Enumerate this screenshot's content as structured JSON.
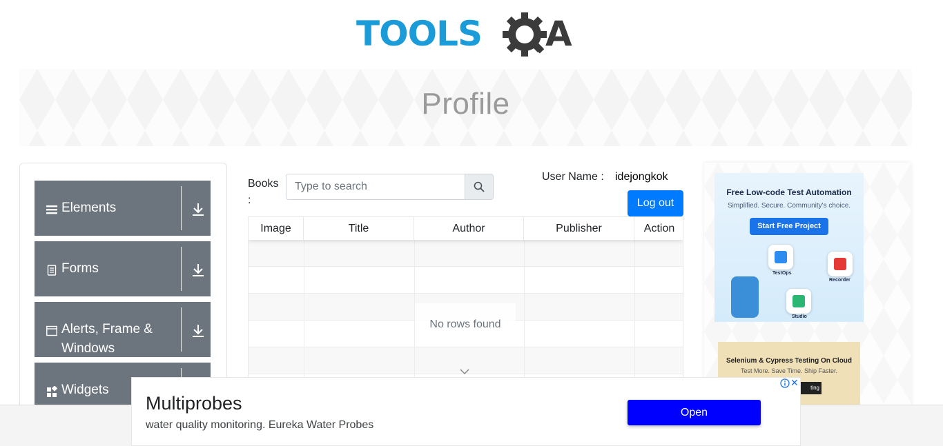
{
  "header": {
    "logo_text_left": "TOOLS",
    "logo_text_right": "QA"
  },
  "banner": {
    "title": "Profile"
  },
  "sidebar": {
    "groups": [
      {
        "label": "Elements",
        "icon": "list-icon"
      },
      {
        "label": "Forms",
        "icon": "document-icon"
      },
      {
        "label": "Alerts, Frame &",
        "label2": "Windows",
        "icon": "window-icon"
      },
      {
        "label": "Widgets",
        "icon": "widgets-icon"
      }
    ]
  },
  "main": {
    "books_label": "Books",
    "books_colon": ":",
    "search": {
      "placeholder": "Type to search"
    },
    "user_label": "User Name :",
    "user_value": "idejongkok",
    "logout_label": "Log out",
    "table": {
      "columns": [
        "Image",
        "Title",
        "Author",
        "Publisher",
        "Action"
      ],
      "empty_text": "No rows found"
    }
  },
  "ads": {
    "ad1": {
      "title": "Free Low-code Test Automation",
      "subtitle": "Simplified. Secure. Community's choice.",
      "button": "Start Free Project",
      "labels": [
        "TestOps",
        "Recorder",
        "Studio"
      ]
    },
    "ad2": {
      "title": "Selenium & Cypress Testing On Cloud",
      "subtitle": "Test More. Save Time. Ship Faster.",
      "button": "ting"
    }
  },
  "bottom_ad": {
    "title": "Multiprobes",
    "description": "water quality monitoring. Eureka Water Probes",
    "button": "Open"
  },
  "colors": {
    "brand_blue": "#1b9cd8",
    "logo_dark": "#3b3b3b",
    "sidebar_group": "#6c757d",
    "primary_button": "#007bff",
    "ad_open_button": "#0000ff"
  }
}
